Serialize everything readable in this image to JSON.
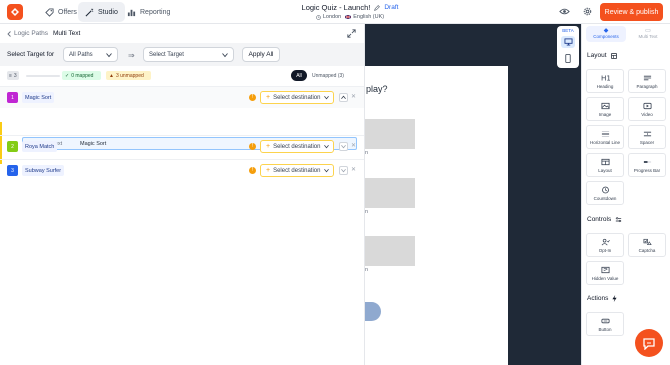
{
  "nav": {
    "items": [
      {
        "label": "Offers",
        "icon": "tag-icon",
        "active": false
      },
      {
        "label": "Studio",
        "icon": "wand-icon",
        "active": true
      },
      {
        "label": "Reporting",
        "icon": "bar-chart-icon",
        "active": false
      }
    ]
  },
  "header": {
    "title": "Logic Quiz - Launch!",
    "status": "Draft",
    "location": "London",
    "language": "English (UK)",
    "publish_label": "Review & publish"
  },
  "panel": {
    "breadcrumb_back": "Logic Paths",
    "breadcrumb_current": "Multi Text",
    "select_target_label": "Select Target for",
    "paths_select": "All Paths",
    "target_select": "Select Target",
    "apply_label": "Apply All",
    "count": "3",
    "progress_mapped": 0,
    "mapped_badge": "0 mapped",
    "unmapped_badge": "3 unmapped",
    "filter_all": "All",
    "filter_unmapped": "Unmapped (3)",
    "rows": [
      {
        "num": "1",
        "label": "Magic Sort",
        "color": "#c026d3",
        "destination": "Select destination"
      },
      {
        "num": "2",
        "label": "Roya Match",
        "color": "#84cc16",
        "destination": "Select destination"
      },
      {
        "num": "3",
        "label": "Subway Surfer",
        "color": "#2563eb",
        "destination": "Select destination"
      }
    ],
    "sub_row": {
      "type": "Multi Text",
      "name": "Magic Sort"
    }
  },
  "preview": {
    "question_fragment": "play?",
    "option_fragment": "n"
  },
  "device": {
    "beta": "BETA"
  },
  "sidebar": {
    "tabs": [
      {
        "label": "Components",
        "active": true
      },
      {
        "label": "Multi Text",
        "active": false
      }
    ],
    "layout_title": "Layout",
    "layout_items": [
      {
        "label": "Heading",
        "icon": "heading-icon"
      },
      {
        "label": "Paragraph",
        "icon": "paragraph-icon"
      },
      {
        "label": "Image",
        "icon": "image-icon"
      },
      {
        "label": "Video",
        "icon": "video-icon"
      },
      {
        "label": "Horizontal Line",
        "icon": "horizontal-line-icon"
      },
      {
        "label": "Spacer",
        "icon": "spacer-icon"
      },
      {
        "label": "Layout",
        "icon": "layout-icon"
      },
      {
        "label": "Progress Bar",
        "icon": "progress-bar-icon"
      },
      {
        "label": "Countdown",
        "icon": "countdown-icon"
      }
    ],
    "controls_title": "Controls",
    "controls_items": [
      {
        "label": "Opt-In",
        "icon": "opt-in-icon"
      },
      {
        "label": "Captcha",
        "icon": "captcha-icon"
      },
      {
        "label": "Hidden Value",
        "icon": "hidden-value-icon"
      }
    ],
    "actions_title": "Actions",
    "actions_items": [
      {
        "label": "Button",
        "icon": "button-icon"
      }
    ]
  },
  "colors": {
    "accent": "#f4511e",
    "canvas": "#1f2937",
    "link": "#2563eb"
  }
}
